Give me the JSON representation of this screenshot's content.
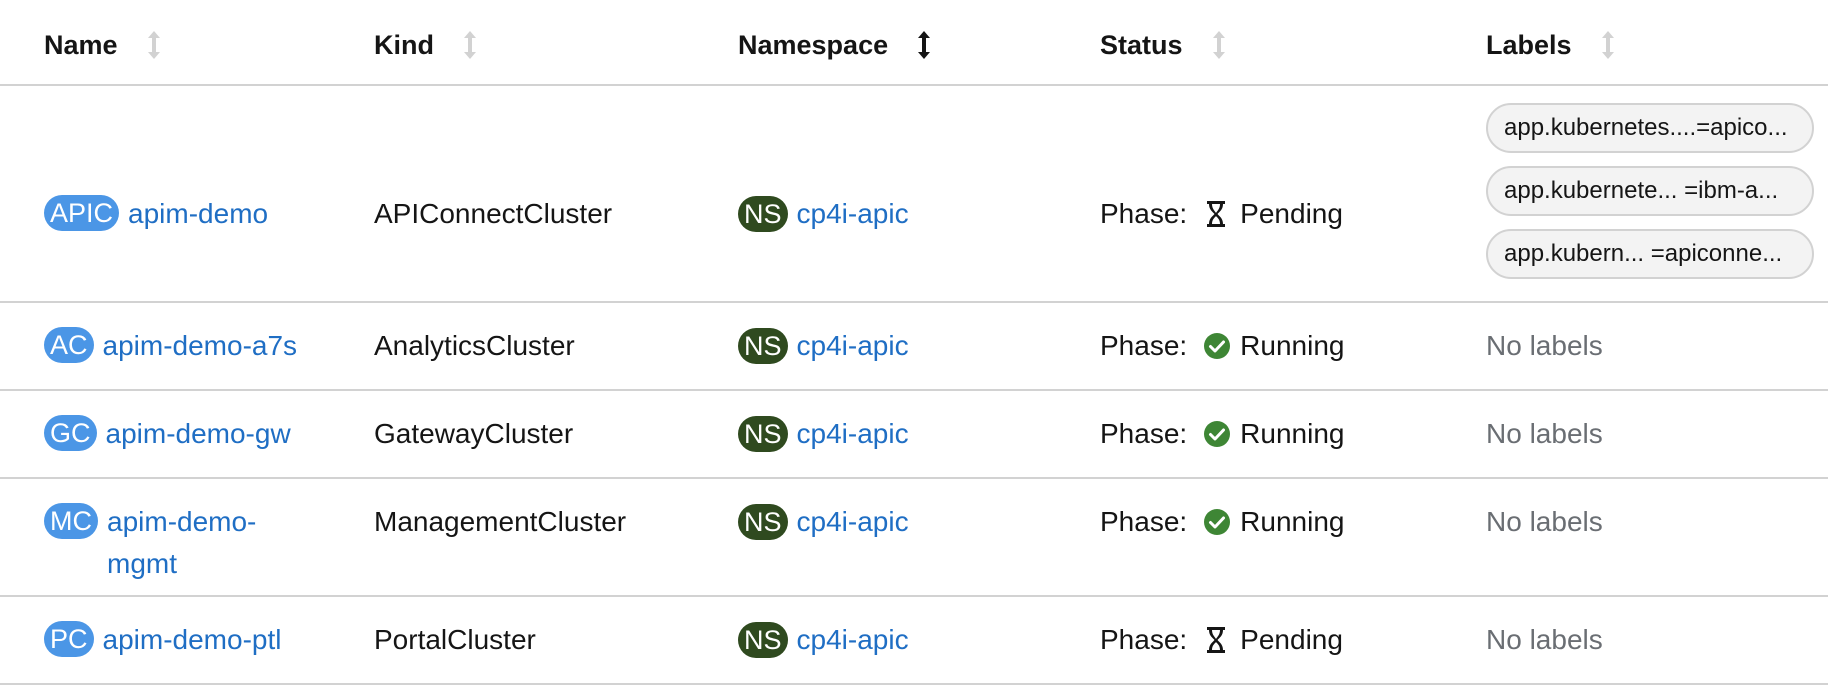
{
  "columns": [
    {
      "label": "Name",
      "sort": "unsorted"
    },
    {
      "label": "Kind",
      "sort": "unsorted"
    },
    {
      "label": "Namespace",
      "sort": "active"
    },
    {
      "label": "Status",
      "sort": "unsorted"
    },
    {
      "label": "Labels",
      "sort": "unsorted"
    }
  ],
  "rows": [
    {
      "badge": "APIC",
      "name": "apim-demo",
      "kind": "APIConnectCluster",
      "ns_badge": "NS",
      "namespace": "cp4i-apic",
      "phase_label": "Phase:",
      "status_icon": "hourglass-icon",
      "status": "Pending",
      "labels": [
        "app.kubernetes....=apico...",
        "app.kubernete... =ibm-a...",
        "app.kubern... =apiconne..."
      ],
      "no_labels": ""
    },
    {
      "badge": "AC",
      "name": "apim-demo-a7s",
      "kind": "AnalyticsCluster",
      "ns_badge": "NS",
      "namespace": "cp4i-apic",
      "phase_label": "Phase:",
      "status_icon": "check-circle-icon",
      "status": "Running",
      "labels": [],
      "no_labels": "No labels"
    },
    {
      "badge": "GC",
      "name": "apim-demo-gw",
      "kind": "GatewayCluster",
      "ns_badge": "NS",
      "namespace": "cp4i-apic",
      "phase_label": "Phase:",
      "status_icon": "check-circle-icon",
      "status": "Running",
      "labels": [],
      "no_labels": "No labels"
    },
    {
      "badge": "MC",
      "name": "apim-demo-mgmt",
      "name_line1": "apim-demo-",
      "name_line2": "mgmt",
      "kind": "ManagementCluster",
      "ns_badge": "NS",
      "namespace": "cp4i-apic",
      "phase_label": "Phase:",
      "status_icon": "check-circle-icon",
      "status": "Running",
      "labels": [],
      "no_labels": "No labels"
    },
    {
      "badge": "PC",
      "name": "apim-demo-ptl",
      "kind": "PortalCluster",
      "ns_badge": "NS",
      "namespace": "cp4i-apic",
      "phase_label": "Phase:",
      "status_icon": "hourglass-icon",
      "status": "Pending",
      "labels": [],
      "no_labels": "No labels"
    }
  ],
  "colors": {
    "kind_badge": "#4b96e6",
    "ns_badge": "#2f4a1f",
    "link": "#1f6ec4",
    "running": "#3e8635",
    "divider": "#d2d2d2"
  }
}
